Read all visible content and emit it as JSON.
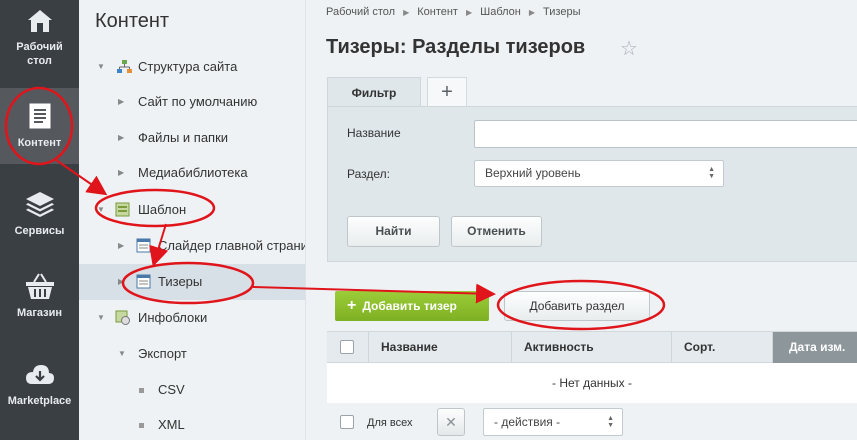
{
  "sidebar": {
    "items": [
      {
        "label_line1": "Рабочий",
        "label_line2": "стол",
        "icon": "house-icon"
      },
      {
        "label": "Контент",
        "icon": "document-icon"
      },
      {
        "label": "Сервисы",
        "icon": "layers-icon"
      },
      {
        "label": "Магазин",
        "icon": "basket-icon"
      },
      {
        "label": "Marketplace",
        "icon": "cloud-download-icon"
      }
    ]
  },
  "menu": {
    "title": "Контент",
    "items": [
      {
        "label": "Структура сайта",
        "icon": "site-structure-icon"
      },
      {
        "label": "Сайт по умолчанию"
      },
      {
        "label": "Файлы и папки"
      },
      {
        "label": "Медиабиблиотека"
      },
      {
        "label": "Шаблон",
        "icon": "template-icon"
      },
      {
        "label": "Слайдер главной страни",
        "icon": "list-icon"
      },
      {
        "label": "Тизеры",
        "icon": "list-icon"
      },
      {
        "label": "Инфоблоки",
        "icon": "infoblock-icon"
      },
      {
        "label": "Экспорт"
      },
      {
        "label": "CSV"
      },
      {
        "label": "XML"
      }
    ]
  },
  "breadcrumbs": [
    "Рабочий стол",
    "Контент",
    "Шаблон",
    "Тизеры"
  ],
  "page": {
    "title": "Тизеры: Разделы тизеров"
  },
  "filter": {
    "tab_label": "Фильтр",
    "add_tab": "+",
    "name_label": "Название",
    "name_value": "",
    "section_label": "Раздел:",
    "section_value": "Верхний уровень",
    "find_button": "Найти",
    "cancel_button": "Отменить"
  },
  "toolbar": {
    "add_teaser": "Добавить тизер",
    "add_section": "Добавить раздел"
  },
  "table": {
    "columns": [
      "Название",
      "Активность",
      "Сорт.",
      "Дата изм."
    ],
    "empty_text": "- Нет данных -",
    "footer_label": "Для всех",
    "actions_value": "- действия -"
  },
  "colors": {
    "sidebar_bg": "#3a3f44",
    "accent_green": "#8cc031",
    "annotation_red": "#e0151b"
  }
}
